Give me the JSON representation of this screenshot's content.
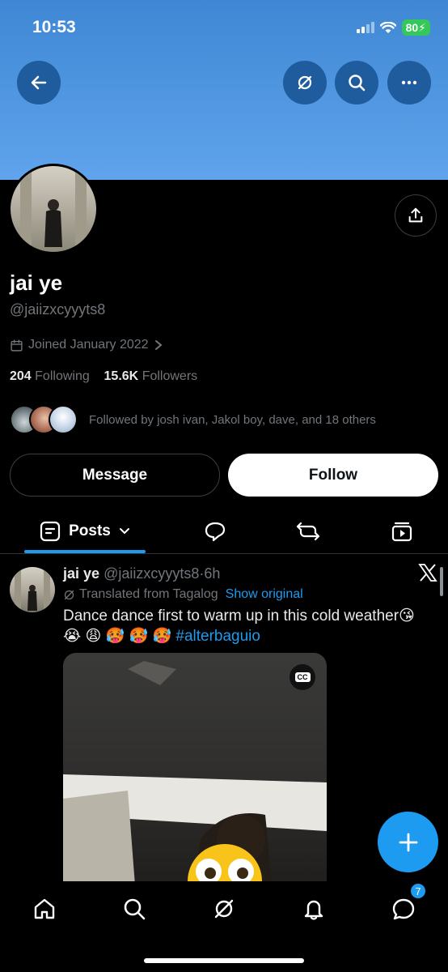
{
  "status_bar": {
    "time": "10:53",
    "battery": "80"
  },
  "profile": {
    "name": "jai ye",
    "handle": "@jaiizxcyyyts8",
    "joined": "Joined January 2022",
    "following_count": "204",
    "following_label": "Following",
    "followers_count": "15.6K",
    "followers_label": "Followers",
    "followed_by": "Followed by josh ivan, Jakol boy, dave, and 18 others"
  },
  "actions": {
    "message_label": "Message",
    "follow_label": "Follow"
  },
  "tabs": {
    "posts_label": "Posts"
  },
  "post": {
    "author_name": "jai ye",
    "author_handle": "@jaiizxcyyyts8",
    "separator": "·",
    "time_ago": "6h",
    "translated_label": "Translated from Tagalog",
    "show_original": "Show original",
    "text": "Dance dance first to warm up in this cold weather😘",
    "emojis": "😭 😩 🥵 🥵 🥵",
    "hashtag": "#alterbaguio",
    "cc_label": "CC"
  },
  "bottom_nav": {
    "messages_badge": "7"
  },
  "colors": {
    "accent": "#1d9bf0",
    "banner": "#4a93e0",
    "background": "#000000"
  },
  "icons": [
    "back-arrow-icon",
    "grok-icon",
    "search-icon",
    "more-icon",
    "share-icon",
    "calendar-icon",
    "chevron-right-icon",
    "chevron-down-icon",
    "replies-icon",
    "retweet-icon",
    "media-icon",
    "x-logo-icon",
    "translate-icon",
    "plus-icon",
    "home-icon",
    "notifications-icon",
    "messages-icon"
  ]
}
